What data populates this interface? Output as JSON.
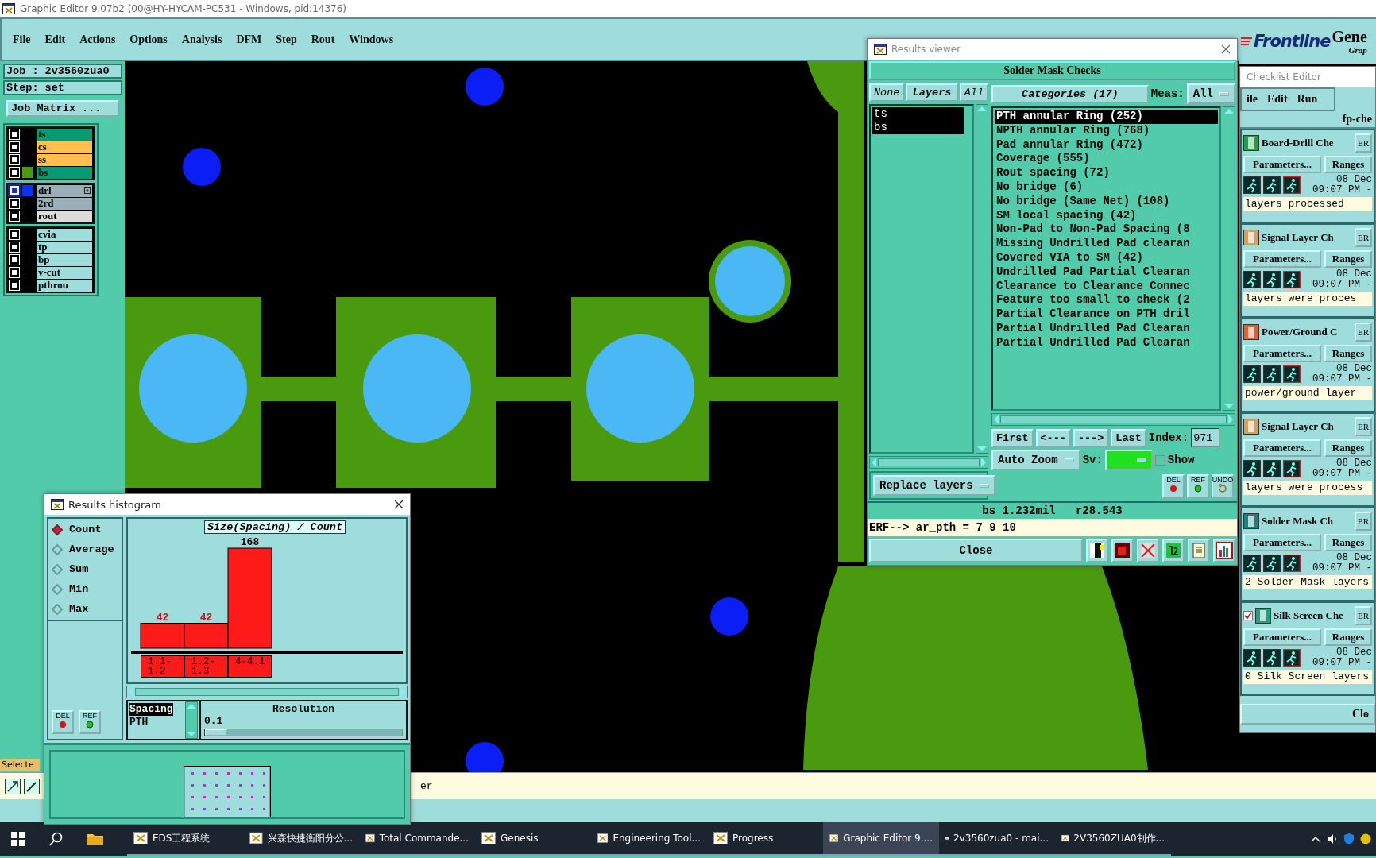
{
  "window": {
    "title": "Graphic Editor 9.07b2 (00@HY-HYCAM-PC531 - Windows, pid:14376)"
  },
  "menu": [
    "File",
    "Edit",
    "Actions",
    "Options",
    "Analysis",
    "DFM",
    "Step",
    "Rout",
    "Windows"
  ],
  "job_panel": {
    "job": "Job : 2v3560zua0",
    "step": "Step: set",
    "matrix_button": "Job Matrix ...",
    "layer_groups": [
      {
        "layers": [
          {
            "name": "ts",
            "color": "#089a70",
            "selected": false
          },
          {
            "name": "cs",
            "color": "#ffc050",
            "selected": false
          },
          {
            "name": "ss",
            "color": "#ffc050",
            "selected": false
          },
          {
            "name": "bs",
            "color": "#089a70",
            "selected": false,
            "swatch": {
              "color": "#4a9a10"
            }
          }
        ]
      },
      {
        "layers": [
          {
            "name": "drl",
            "color": "#9ab0b8",
            "selected": true,
            "swatch": {
              "color": "#0a32ff"
            }
          },
          {
            "name": "2rd",
            "color": "#9ab0b8",
            "selected": false
          },
          {
            "name": "rout",
            "color": "#dcdcdc",
            "selected": false
          }
        ]
      },
      {
        "layers": [
          {
            "name": "cvia",
            "color": "#9fdcdc",
            "selected": false
          },
          {
            "name": "tp",
            "color": "#9fdcdc",
            "selected": false
          },
          {
            "name": "bp",
            "color": "#9fdcdc",
            "selected": false
          },
          {
            "name": "v-cut",
            "color": "#9fdcdc",
            "selected": false
          },
          {
            "name": "pthrou",
            "color": "#9fdcdc",
            "selected": false
          }
        ]
      }
    ],
    "selection_label": "Selecte"
  },
  "status_bar": {
    "text": "er"
  },
  "banner": {
    "logo": "Frontline",
    "product": "Gene",
    "subtitle": "Grap"
  },
  "results_viewer": {
    "title": "Results viewer",
    "heading": "Solder Mask Checks",
    "layer_buttons": [
      "None",
      "Layers",
      "All"
    ],
    "layers": [
      {
        "name": "ts",
        "selected": true
      },
      {
        "name": "bs",
        "selected": true
      }
    ],
    "replace_layers": "Replace layers",
    "categories_button": "Categories (17)",
    "meas_label": "Meas:",
    "meas_value": "All",
    "categories": [
      {
        "label": "PTH annular Ring (252)",
        "selected": true
      },
      {
        "label": "NPTH annular Ring (768)",
        "selected": false
      },
      {
        "label": "Pad annular Ring (472)",
        "selected": false
      },
      {
        "label": "Coverage (555)",
        "selected": false
      },
      {
        "label": "Rout spacing (72)",
        "selected": false
      },
      {
        "label": "No bridge (6)",
        "selected": false
      },
      {
        "label": "No bridge (Same Net) (108)",
        "selected": false
      },
      {
        "label": "SM local spacing (42)",
        "selected": false
      },
      {
        "label": "Non-Pad to Non-Pad Spacing (8",
        "selected": false
      },
      {
        "label": "Missing Undrilled Pad clearan",
        "selected": false
      },
      {
        "label": "Covered VIA to SM (42)",
        "selected": false
      },
      {
        "label": "Undrilled Pad Partial Clearan",
        "selected": false
      },
      {
        "label": "Clearance to Clearance Connec",
        "selected": false
      },
      {
        "label": "Feature too small to check (2",
        "selected": false
      },
      {
        "label": "Partial Clearance on PTH dril",
        "selected": false
      },
      {
        "label": "Partial Undrilled Pad Clearan",
        "selected": false
      },
      {
        "label": "Partial Undrilled Pad Clearan",
        "selected": false
      }
    ],
    "nav": [
      "First",
      "<---",
      "--->",
      "Last"
    ],
    "index_label": "Index:",
    "index_value": "971",
    "zoom_mode": "Auto Zoom",
    "sv_label": "Sv:",
    "show_label": "Show",
    "show_checked": false,
    "tool_buttons": [
      {
        "label": "DEL",
        "kind": "del"
      },
      {
        "label": "REF",
        "kind": "ref"
      },
      {
        "label": "UNDO",
        "kind": "undo"
      }
    ],
    "measurement": "bs 1.232mil   r28.543",
    "erf_line": "ERF--> ar_pth = 7 9 10",
    "close": "Close"
  },
  "histogram": {
    "title": "Results histogram",
    "modes": [
      {
        "label": "Count",
        "selected": true
      },
      {
        "label": "Average",
        "selected": false
      },
      {
        "label": "Sum",
        "selected": false
      },
      {
        "label": "Min",
        "selected": false
      },
      {
        "label": "Max",
        "selected": false
      }
    ],
    "buttons": [
      {
        "label": "DEL",
        "kind": "del"
      },
      {
        "label": "REF",
        "kind": "ref"
      }
    ],
    "chart_data": {
      "type": "bar",
      "title": "Size(Spacing) / Count",
      "categories": [
        "1.1-1.2",
        "1.2-1.3",
        "4-4.1"
      ],
      "values": [
        42,
        42,
        168
      ],
      "data_labels": true
    },
    "attributes": [
      {
        "label": "Spacing",
        "selected": true
      },
      {
        "label": "PTH",
        "selected": false
      }
    ],
    "resolution_label": "Resolution",
    "resolution_value": "0.1",
    "level": 0
  },
  "checklist": {
    "title": "Checklist Editor",
    "menu": [
      "ile",
      "Edit",
      "Run"
    ],
    "name": "fp-che",
    "checks": [
      {
        "name": "Board-Drill Che",
        "kind": "drill",
        "checked": false,
        "erf": "ER",
        "params": "Parameters...",
        "ranges": "Ranges",
        "date": "08 Dec",
        "time": "09:07 PM -",
        "message": "layers processed"
      },
      {
        "name": "Signal Layer Ch",
        "kind": "signal",
        "checked": false,
        "erf": "ER",
        "params": "Parameters...",
        "ranges": "Ranges",
        "date": "08 Dec",
        "time": "09:07 PM -",
        "message": "layers were proces"
      },
      {
        "name": "Power/Ground C",
        "kind": "power",
        "checked": false,
        "erf": "ER",
        "params": "Parameters...",
        "ranges": "Ranges",
        "date": "08 Dec",
        "time": "09:07 PM -",
        "message": "power/ground layer"
      },
      {
        "name": "Signal Layer Ch",
        "kind": "signal",
        "checked": false,
        "erf": "ER",
        "params": "Parameters...",
        "ranges": "Ranges",
        "date": "08 Dec",
        "time": "09:07 PM -",
        "message": "layers were process"
      },
      {
        "name": "Solder Mask Ch",
        "kind": "mask",
        "checked": false,
        "erf": "ER",
        "params": "Parameters...",
        "ranges": "Ranges",
        "date": "08 Dec",
        "time": "09:07 PM -",
        "message": "2 Solder Mask layers"
      },
      {
        "name": "Silk Screen Che",
        "kind": "silk",
        "checked": true,
        "erf": "ER",
        "params": "Parameters...",
        "ranges": "Ranges",
        "date": "08 Dec",
        "time": "09:07 PM -",
        "message": "0 Silk Screen layers"
      }
    ],
    "close": "Clo"
  },
  "taskbar": {
    "items": [
      {
        "label": "EDS工程系统",
        "selected": false
      },
      {
        "label": "兴森快捷衡阳分公...",
        "selected": false
      },
      {
        "label": "Total Commande...",
        "selected": false
      },
      {
        "label": "Genesis",
        "selected": false
      },
      {
        "label": "Engineering Tool...",
        "selected": false
      },
      {
        "label": "Progress",
        "selected": false
      },
      {
        "label": "Graphic Editor 9....",
        "selected": true
      },
      {
        "label": "2v3560zua0 - mai...",
        "selected": false
      },
      {
        "label": "2V3560ZUA0制作...",
        "selected": false
      }
    ]
  }
}
